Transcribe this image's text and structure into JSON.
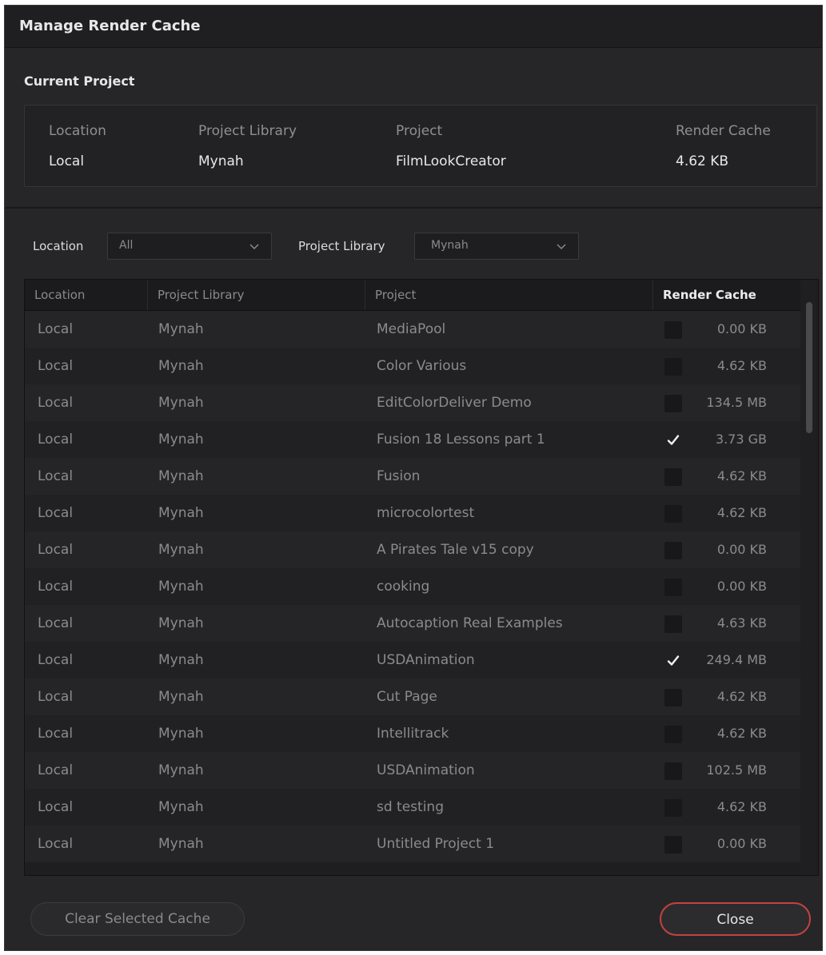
{
  "window": {
    "title": "Manage Render Cache"
  },
  "current_project": {
    "section_title": "Current Project",
    "headers": [
      "Location",
      "Project Library",
      "Project",
      "Render Cache"
    ],
    "values": [
      "Local",
      "Mynah",
      "FilmLookCreator",
      "4.62 KB"
    ]
  },
  "filters": {
    "location_label": "Location",
    "location_value": "All",
    "library_label": "Project Library",
    "library_value": "Mynah"
  },
  "table": {
    "columns": [
      "Location",
      "Project Library",
      "Project",
      "Render Cache"
    ],
    "rows": [
      {
        "location": "Local",
        "library": "Mynah",
        "project": "MediaPool",
        "checked": false,
        "size": "0.00 KB"
      },
      {
        "location": "Local",
        "library": "Mynah",
        "project": "Color Various",
        "checked": false,
        "size": "4.62 KB"
      },
      {
        "location": "Local",
        "library": "Mynah",
        "project": "EditColorDeliver Demo",
        "checked": false,
        "size": "134.5 MB"
      },
      {
        "location": "Local",
        "library": "Mynah",
        "project": "Fusion 18  Lessons part 1",
        "checked": true,
        "size": "3.73 GB"
      },
      {
        "location": "Local",
        "library": "Mynah",
        "project": "Fusion",
        "checked": false,
        "size": "4.62 KB"
      },
      {
        "location": "Local",
        "library": "Mynah",
        "project": "microcolortest",
        "checked": false,
        "size": "4.62 KB"
      },
      {
        "location": "Local",
        "library": "Mynah",
        "project": "A Pirates Tale v15 copy",
        "checked": false,
        "size": "0.00 KB"
      },
      {
        "location": "Local",
        "library": "Mynah",
        "project": "cooking",
        "checked": false,
        "size": "0.00 KB"
      },
      {
        "location": "Local",
        "library": "Mynah",
        "project": "Autocaption Real Examples",
        "checked": false,
        "size": "4.63 KB"
      },
      {
        "location": "Local",
        "library": "Mynah",
        "project": "USDAnimation",
        "checked": true,
        "size": "249.4 MB"
      },
      {
        "location": "Local",
        "library": "Mynah",
        "project": "Cut Page",
        "checked": false,
        "size": "4.62 KB"
      },
      {
        "location": "Local",
        "library": "Mynah",
        "project": "Intellitrack",
        "checked": false,
        "size": "4.62 KB"
      },
      {
        "location": "Local",
        "library": "Mynah",
        "project": "USDAnimation",
        "checked": false,
        "size": "102.5 MB"
      },
      {
        "location": "Local",
        "library": "Mynah",
        "project": "sd testing",
        "checked": false,
        "size": "4.62 KB"
      },
      {
        "location": "Local",
        "library": "Mynah",
        "project": "Untitled Project 1",
        "checked": false,
        "size": "0.00 KB"
      }
    ]
  },
  "buttons": {
    "clear": "Clear Selected Cache",
    "close": "Close"
  },
  "colors": {
    "close_border": "#c2433e",
    "dialog_bg": "#262628"
  }
}
